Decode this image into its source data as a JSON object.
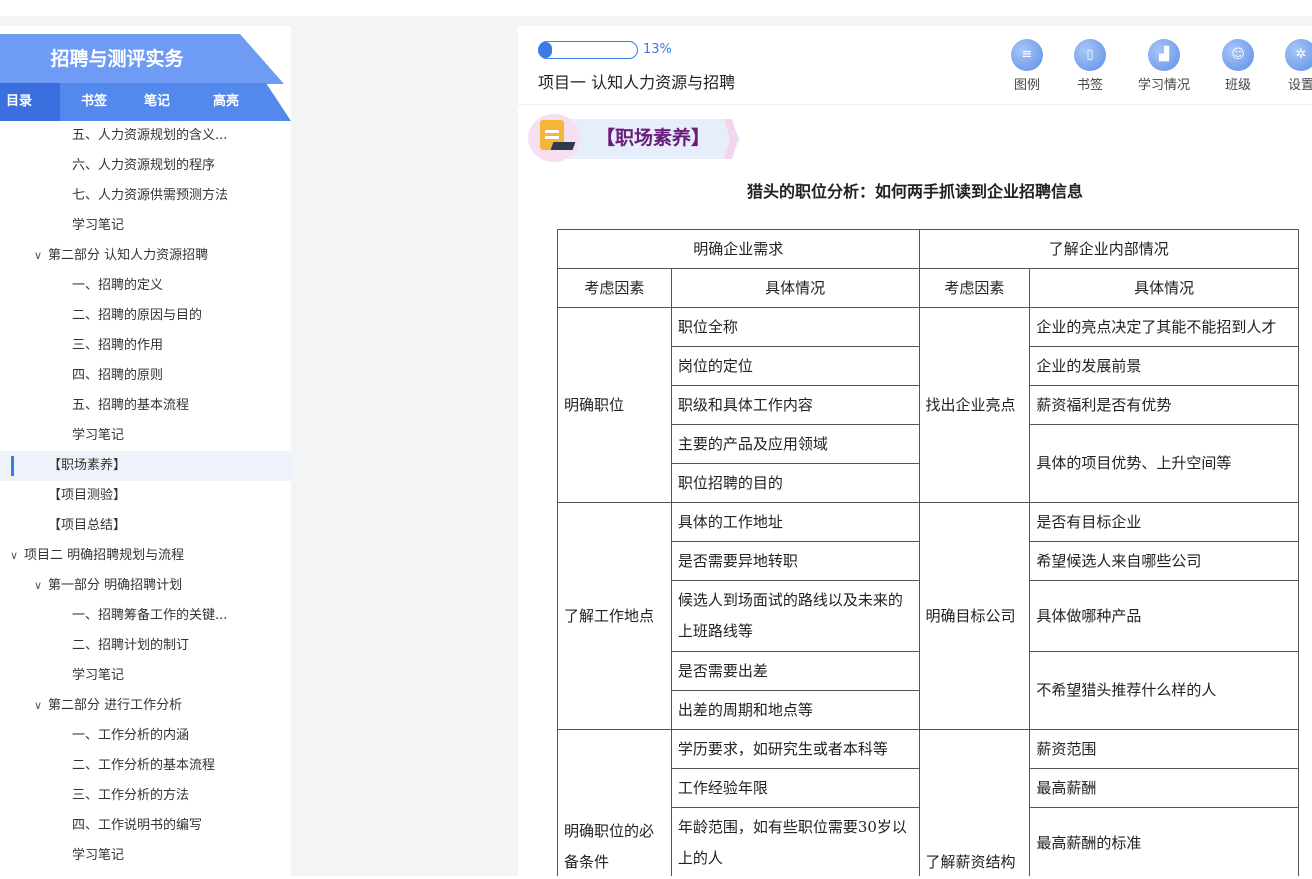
{
  "sidebar": {
    "book_title": "招聘与测评实务",
    "tabs": {
      "toc": "目录",
      "bookmark": "书签",
      "notes": "笔记",
      "highlight": "高亮"
    },
    "toc_items": [
      {
        "label": "五、人力资源规划的含义...",
        "indent": 2,
        "caret": false
      },
      {
        "label": "六、人力资源规划的程序",
        "indent": 2,
        "caret": false
      },
      {
        "label": "七、人力资源供需预测方法",
        "indent": 2,
        "caret": false
      },
      {
        "label": "学习笔记",
        "indent": 2,
        "caret": false
      },
      {
        "label": "第二部分 认知人力资源招聘",
        "indent": 1,
        "caret": true
      },
      {
        "label": "一、招聘的定义",
        "indent": 2,
        "caret": false
      },
      {
        "label": "二、招聘的原因与目的",
        "indent": 2,
        "caret": false
      },
      {
        "label": "三、招聘的作用",
        "indent": 2,
        "caret": false
      },
      {
        "label": "四、招聘的原则",
        "indent": 2,
        "caret": false
      },
      {
        "label": "五、招聘的基本流程",
        "indent": 2,
        "caret": false
      },
      {
        "label": "学习笔记",
        "indent": 2,
        "caret": false
      },
      {
        "label": "【职场素养】",
        "indent": 1.5,
        "caret": false,
        "active": true
      },
      {
        "label": "【项目测验】",
        "indent": 1.5,
        "caret": false
      },
      {
        "label": "【项目总结】",
        "indent": 1.5,
        "caret": false
      },
      {
        "label": "项目二 明确招聘规划与流程",
        "indent": 0,
        "caret": true
      },
      {
        "label": "第一部分 明确招聘计划",
        "indent": 1,
        "caret": true
      },
      {
        "label": "一、招聘筹备工作的关键...",
        "indent": 2,
        "caret": false
      },
      {
        "label": "二、招聘计划的制订",
        "indent": 2,
        "caret": false
      },
      {
        "label": "学习笔记",
        "indent": 2,
        "caret": false
      },
      {
        "label": "第二部分 进行工作分析",
        "indent": 1,
        "caret": true
      },
      {
        "label": "一、工作分析的内涵",
        "indent": 2,
        "caret": false
      },
      {
        "label": "二、工作分析的基本流程",
        "indent": 2,
        "caret": false
      },
      {
        "label": "三、工作分析的方法",
        "indent": 2,
        "caret": false
      },
      {
        "label": "四、工作说明书的编写",
        "indent": 2,
        "caret": false
      },
      {
        "label": "学习笔记",
        "indent": 2,
        "caret": false
      }
    ]
  },
  "header": {
    "progress_percent": 13,
    "progress_label": "13%",
    "doc_title": "项目一 认知人力资源与招聘",
    "tools": [
      {
        "label": "图例",
        "icon": "legend-icon"
      },
      {
        "label": "书签",
        "icon": "bookmark-icon"
      },
      {
        "label": "学习情况",
        "icon": "learning-stats-icon"
      },
      {
        "label": "班级",
        "icon": "class-icon"
      },
      {
        "label": "设置",
        "icon": "settings-icon"
      }
    ]
  },
  "content": {
    "section_label": "【职场素养】",
    "article_title": "猎头的职位分析：如何两手抓读到企业招聘信息",
    "table": {
      "group_headers": [
        "明确企业需求",
        "了解企业内部情况"
      ],
      "col_headers": [
        "考虑因素",
        "具体情况",
        "考虑因素",
        "具体情况"
      ],
      "rows": {
        "r1": {
          "left_factor": "明确职位",
          "right_factor": "找出企业亮点"
        },
        "r1_left": [
          "职位全称",
          "岗位的定位",
          "职级和具体工作内容",
          "主要的产品及应用领域",
          "职位招聘的目的"
        ],
        "r1_right": [
          "企业的亮点决定了其能不能招到人才",
          "企业的发展前景",
          "薪资福利是否有优势",
          "具体的项目优势、上升空间等"
        ],
        "r2": {
          "left_factor": "了解工作地点",
          "right_factor": "明确目标公司"
        },
        "r2_left": [
          "具体的工作地址",
          "是否需要异地转职",
          "候选人到场面试的路线以及未来的上班路线等",
          "是否需要出差",
          "出差的周期和地点等"
        ],
        "r2_right": [
          "是否有目标企业",
          "希望候选人来自哪些公司",
          "具体做哪种产品",
          "不希望猎头推荐什么样的人"
        ],
        "r3": {
          "left_factor": "明确职位的必备条件",
          "right_factor": "了解薪资结构"
        },
        "r3_left": [
          "学历要求，如研究生或者本科等",
          "工作经验年限",
          "年龄范围，如有些职位需要30岁以上的人"
        ],
        "r3_right": [
          "薪资范围",
          "最高薪酬",
          "最高薪酬的标准"
        ]
      }
    }
  }
}
